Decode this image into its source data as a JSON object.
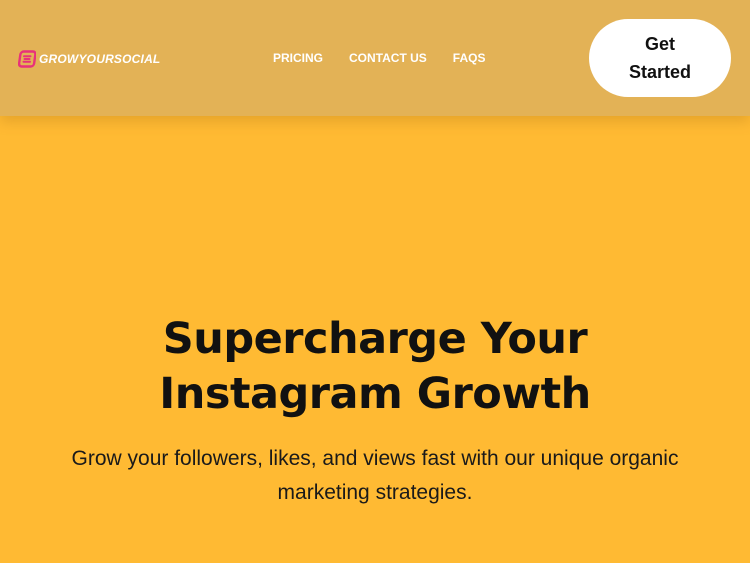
{
  "header": {
    "logo_text": "GROWYOURSOCIAL",
    "nav": [
      {
        "label": "PRICING"
      },
      {
        "label": "CONTACT US"
      },
      {
        "label": "FAQS"
      }
    ],
    "cta_label": "Get Started"
  },
  "hero": {
    "title": "Supercharge Your Instagram Growth",
    "subtitle": "Grow your followers, likes, and views fast with our unique organic marketing strategies."
  },
  "colors": {
    "background": "#FFBA33",
    "header_background": "#E3B256",
    "logo_accent": "#E8317A",
    "cta_background": "#FFFFFF",
    "text_dark": "#111111"
  },
  "icons": {
    "logo_mark": "growyoursocial-logo-icon"
  }
}
